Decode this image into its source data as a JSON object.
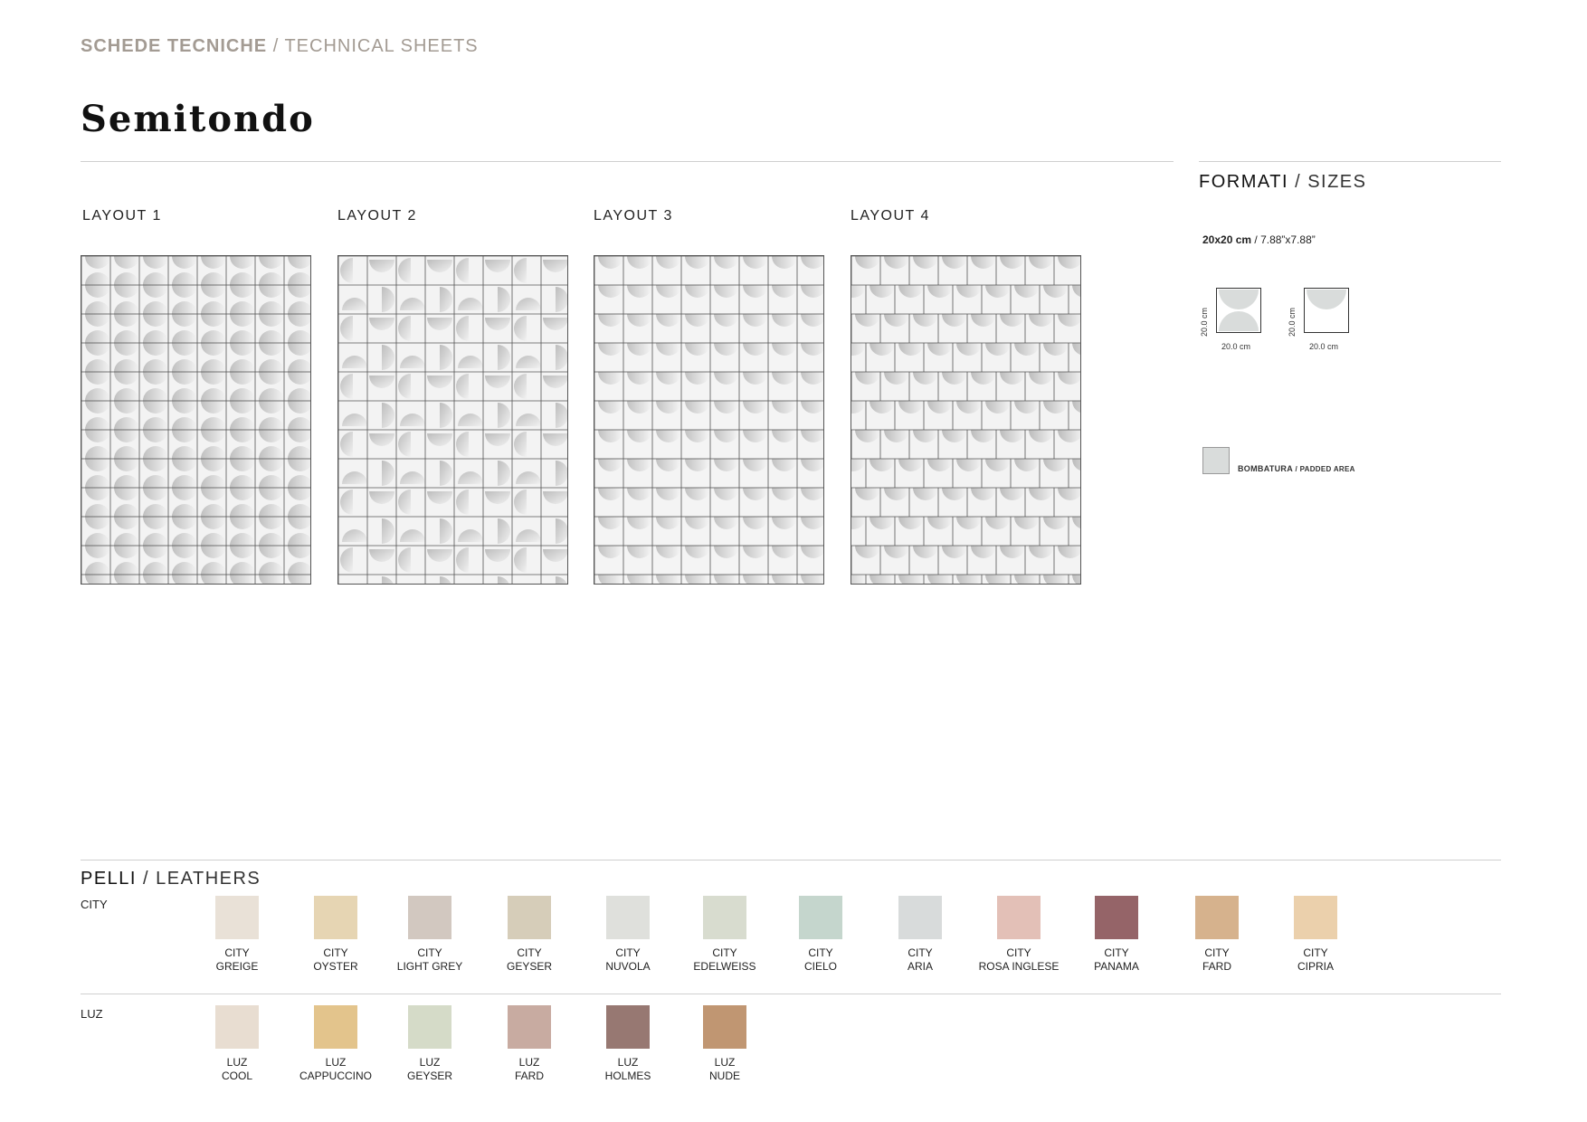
{
  "header": {
    "kicker_it": "SCHEDE TECNICHE",
    "kicker_sep": " / ",
    "kicker_en": "TECHNICAL SHEETS",
    "title": "Semitondo"
  },
  "layouts": [
    {
      "label": "LAYOUT 1",
      "pattern": "vertical-stacked-semicircles"
    },
    {
      "label": "LAYOUT 2",
      "pattern": "alternating-rotated-semicircles"
    },
    {
      "label": "LAYOUT 3",
      "pattern": "offset-top-semicircles"
    },
    {
      "label": "LAYOUT 4",
      "pattern": "brick-offset-semicircles"
    }
  ],
  "formats": {
    "heading_it": "FORMATI",
    "heading_sep": " / ",
    "heading_en": "SIZES",
    "size_cm": "20x20 cm",
    "size_sep": " / ",
    "size_in": "7.88”x7.88”",
    "tile_width_label": "20.0 cm",
    "tile_height_label": "20.0 cm",
    "padded_it": "BOMBATURA",
    "padded_sep": " / ",
    "padded_en": "PADDED AREA",
    "padded_color": "#d9dcdb"
  },
  "leathers": {
    "heading_it": "PELLI",
    "heading_sep": " / ",
    "heading_en": "LEATHERS",
    "rows": [
      {
        "label": "CITY",
        "items": [
          {
            "line1": "CITY",
            "line2": "GREIGE",
            "color": "#e9e1d7"
          },
          {
            "line1": "CITY",
            "line2": "OYSTER",
            "color": "#e6d5b3"
          },
          {
            "line1": "CITY",
            "line2": "LIGHT GREY",
            "color": "#d2c8c0"
          },
          {
            "line1": "CITY",
            "line2": "GEYSER",
            "color": "#d6cdb9"
          },
          {
            "line1": "CITY",
            "line2": "NUVOLA",
            "color": "#dfe0dc"
          },
          {
            "line1": "CITY",
            "line2": "EDELWEISS",
            "color": "#d8dccf"
          },
          {
            "line1": "CITY",
            "line2": "CIELO",
            "color": "#c5d6cd"
          },
          {
            "line1": "CITY",
            "line2": "ARIA",
            "color": "#d8dbdb"
          },
          {
            "line1": "CITY",
            "line2": "ROSA INGLESE",
            "color": "#e3c0b7"
          },
          {
            "line1": "CITY",
            "line2": "PANAMA",
            "color": "#956468"
          },
          {
            "line1": "CITY",
            "line2": "FARD",
            "color": "#d6b28d"
          },
          {
            "line1": "CITY",
            "line2": "CIPRIA",
            "color": "#ebd0ac"
          }
        ]
      },
      {
        "label": "LUZ",
        "items": [
          {
            "line1": "LUZ",
            "line2": "COOL",
            "color": "#e8ddd1"
          },
          {
            "line1": "LUZ",
            "line2": "CAPPUCCINO",
            "color": "#e3c48c"
          },
          {
            "line1": "LUZ",
            "line2": "GEYSER",
            "color": "#d5dbc8"
          },
          {
            "line1": "LUZ",
            "line2": "FARD",
            "color": "#c8aba1"
          },
          {
            "line1": "LUZ",
            "line2": "HOLMES",
            "color": "#977872"
          },
          {
            "line1": "LUZ",
            "line2": "NUDE",
            "color": "#c09672"
          }
        ]
      }
    ]
  }
}
